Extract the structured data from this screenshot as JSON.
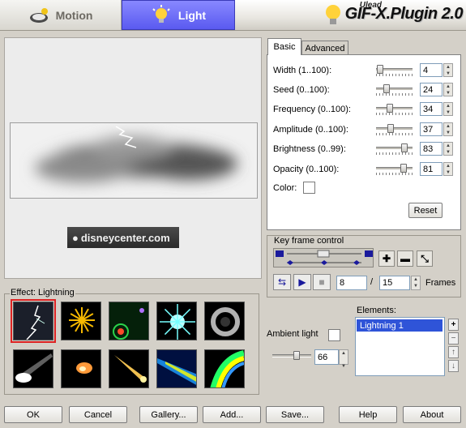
{
  "header": {
    "tabs": [
      {
        "label": "Motion",
        "icon": "motion-icon",
        "active": false
      },
      {
        "label": "Light",
        "icon": "lightbulb-icon",
        "active": true
      }
    ],
    "brand_small": "Ulead",
    "brand_big": "GIF-X.Plugin 2.0"
  },
  "preview": {
    "watermark": "disneycenter.com"
  },
  "panel": {
    "tabs": [
      "Basic",
      "Advanced"
    ],
    "active_tab": "Basic",
    "params": [
      {
        "label": "Width (1..100):",
        "value": "4",
        "level": 4
      },
      {
        "label": "Seed (0..100):",
        "value": "24",
        "level": 24
      },
      {
        "label": "Frequency (0..100):",
        "value": "34",
        "level": 34
      },
      {
        "label": "Amplitude (0..100):",
        "value": "37",
        "level": 37
      },
      {
        "label": "Brightness (0..99):",
        "value": "83",
        "level": 83
      },
      {
        "label": "Opacity (0..100):",
        "value": "81",
        "level": 81
      }
    ],
    "color_label": "Color:",
    "reset_label": "Reset"
  },
  "keyframe": {
    "title": "Key frame control",
    "current_frame": "8",
    "separator": "/",
    "total_frames": "15",
    "frames_label": "Frames"
  },
  "effects": {
    "title": "Effect: Lightning",
    "selected_index": 0,
    "items": [
      "lightning-icon",
      "fireworks-icon",
      "lens-flare-icon",
      "starburst-icon",
      "ring-glow-icon",
      "spotlight-icon",
      "fireball-icon",
      "comet-icon",
      "beam-icon",
      "rainbow-trail-icon"
    ]
  },
  "elements": {
    "title": "Elements:",
    "items": [
      "Lightning 1"
    ]
  },
  "ambient": {
    "label": "Ambient light",
    "value": "66",
    "level": 66
  },
  "buttons": {
    "ok": "OK",
    "cancel": "Cancel",
    "gallery": "Gallery...",
    "add": "Add...",
    "save": "Save...",
    "help": "Help",
    "about": "About"
  },
  "colors": {
    "accent": "#5a5af0",
    "selection": "#2f54d8"
  }
}
